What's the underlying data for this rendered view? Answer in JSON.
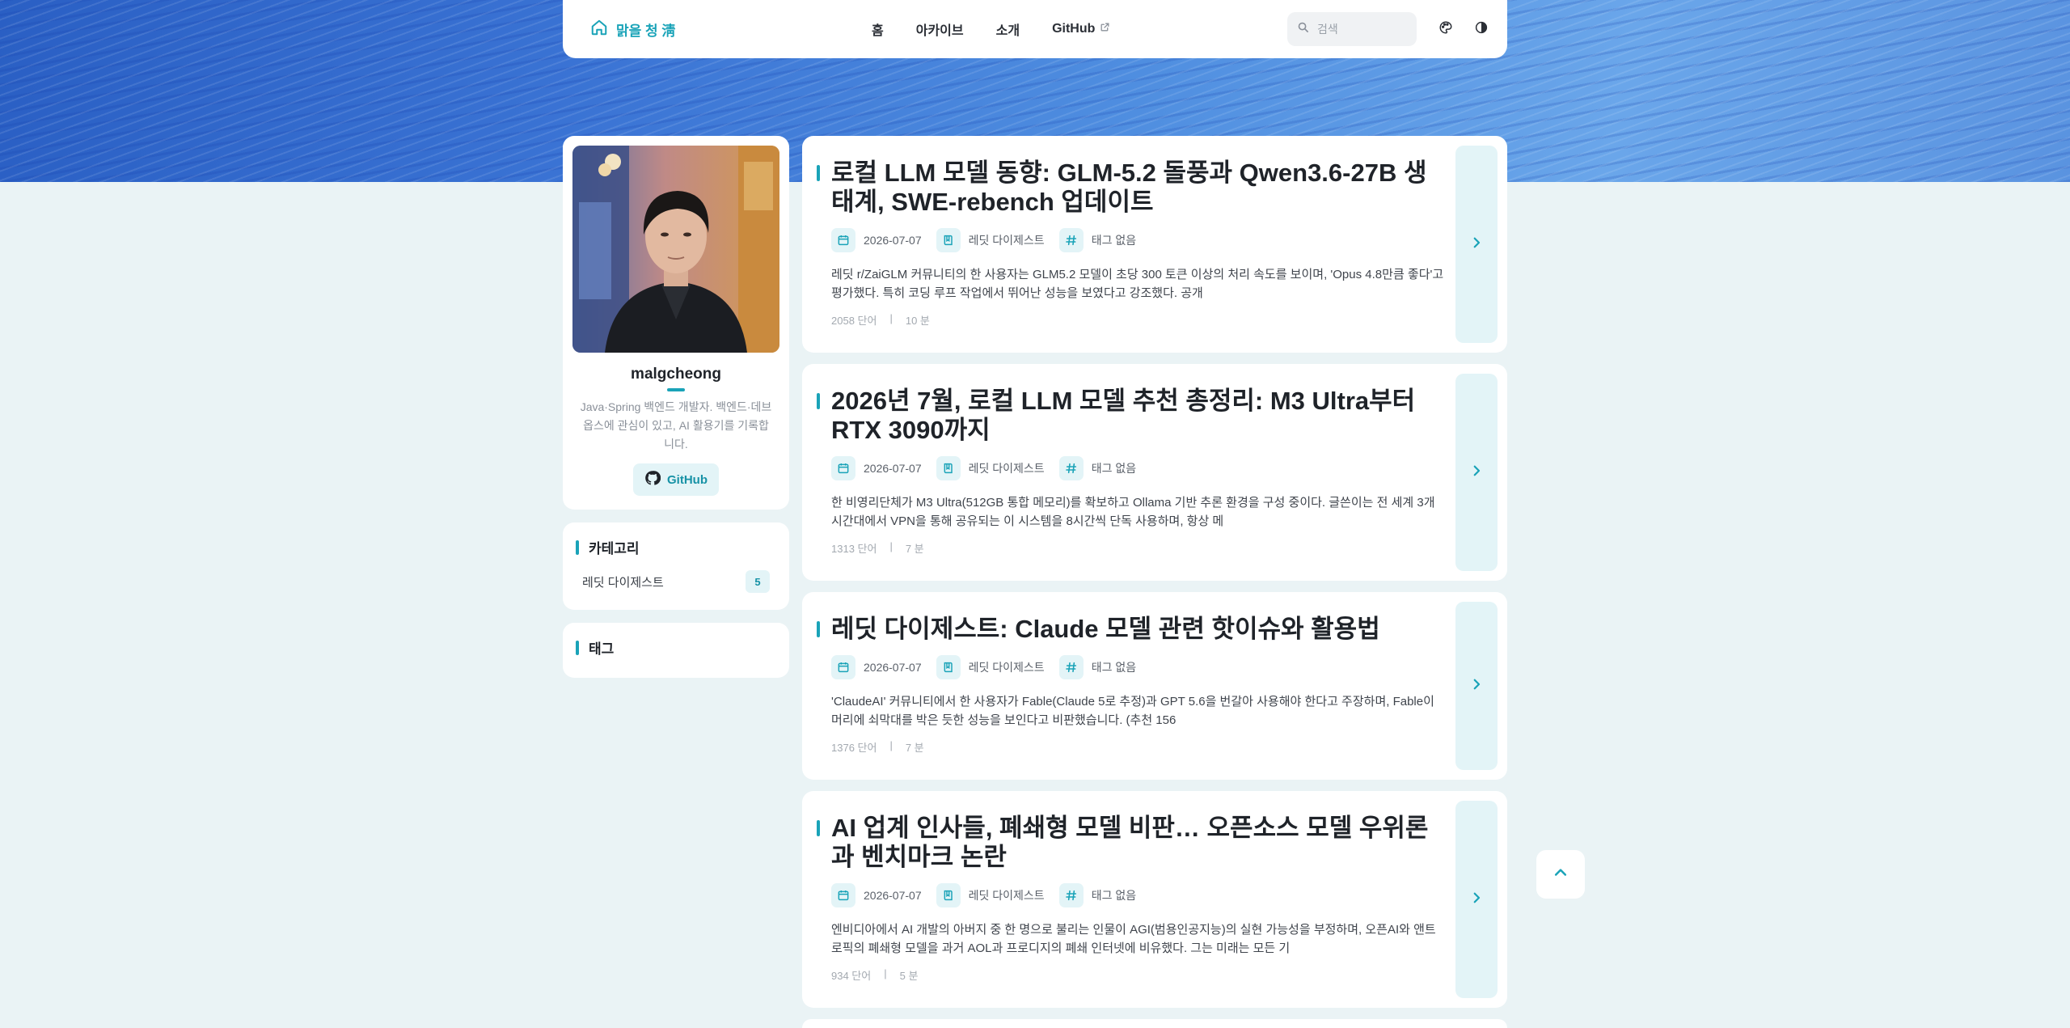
{
  "header": {
    "brand": "맑을 청 淸",
    "nav": [
      "홈",
      "아카이브",
      "소개",
      "GitHub"
    ],
    "search_placeholder": "검색"
  },
  "profile": {
    "name": "malgcheong",
    "bio": "Java·Spring 백엔드 개발자. 백엔드·데브옵스에 관심이 있고, AI 활용기를 기록합니다.",
    "github_label": "GitHub"
  },
  "categories": {
    "title": "카테고리",
    "items": [
      {
        "label": "레딧 다이제스트",
        "count": "5"
      }
    ]
  },
  "tags": {
    "title": "태그"
  },
  "posts": [
    {
      "title": "로컬 LLM 모델 동향: GLM-5.2 돌풍과 Qwen3.6-27B 생태계, SWE-rebench 업데이트",
      "date": "2026-07-07",
      "category": "레딧 다이제스트",
      "tags": "태그 없음",
      "excerpt": "레딧 r/ZaiGLM 커뮤니티의 한 사용자는 GLM5.2 모델이 초당 300 토큰 이상의 처리 속도를 보이며, 'Opus 4.8만큼 좋다'고 평가했다. 특히 코딩 루프 작업에서 뛰어난 성능을 보였다고 강조했다. 공개",
      "words": "2058 단어",
      "minutes": "10 분"
    },
    {
      "title": "2026년 7월, 로컬 LLM 모델 추천 총정리: M3 Ultra부터 RTX 3090까지",
      "date": "2026-07-07",
      "category": "레딧 다이제스트",
      "tags": "태그 없음",
      "excerpt": "한 비영리단체가 M3 Ultra(512GB 통합 메모리)를 확보하고 Ollama 기반 추론 환경을 구성 중이다. 글쓴이는 전 세계 3개 시간대에서 VPN을 통해 공유되는 이 시스템을 8시간씩 단독 사용하며, 항상 메",
      "words": "1313 단어",
      "minutes": "7 분"
    },
    {
      "title": "레딧 다이제스트: Claude 모델 관련 핫이슈와 활용법",
      "date": "2026-07-07",
      "category": "레딧 다이제스트",
      "tags": "태그 없음",
      "excerpt": "'ClaudeAI' 커뮤니티에서 한 사용자가 Fable(Claude 5로 추정)과 GPT 5.6을 번갈아 사용해야 한다고 주장하며, Fable이 머리에 쇠막대를 박은 듯한 성능을 보인다고 비판했습니다. (추천 156",
      "words": "1376 단어",
      "minutes": "7 분"
    },
    {
      "title": "AI 업계 인사들, 폐쇄형 모델 비판… 오픈소스 모델 우위론과 벤치마크 논란",
      "date": "2026-07-07",
      "category": "레딧 다이제스트",
      "tags": "태그 없음",
      "excerpt": "엔비디아에서 AI 개발의 아버지 중 한 명으로 불리는 인물이 AGI(범용인공지능)의 실현 가능성을 부정하며, 오픈AI와 앤트로픽의 폐쇄형 모델을 과거 AOL과 프로디지의 폐쇄 인터넷에 비유했다. 그는 미래는 모든 기",
      "words": "934 단어",
      "minutes": "5 분"
    }
  ],
  "colors": {
    "accent": "#1aa3b8",
    "accent_soft": "#e3f4f7",
    "page_bg": "#eaf3f5"
  }
}
